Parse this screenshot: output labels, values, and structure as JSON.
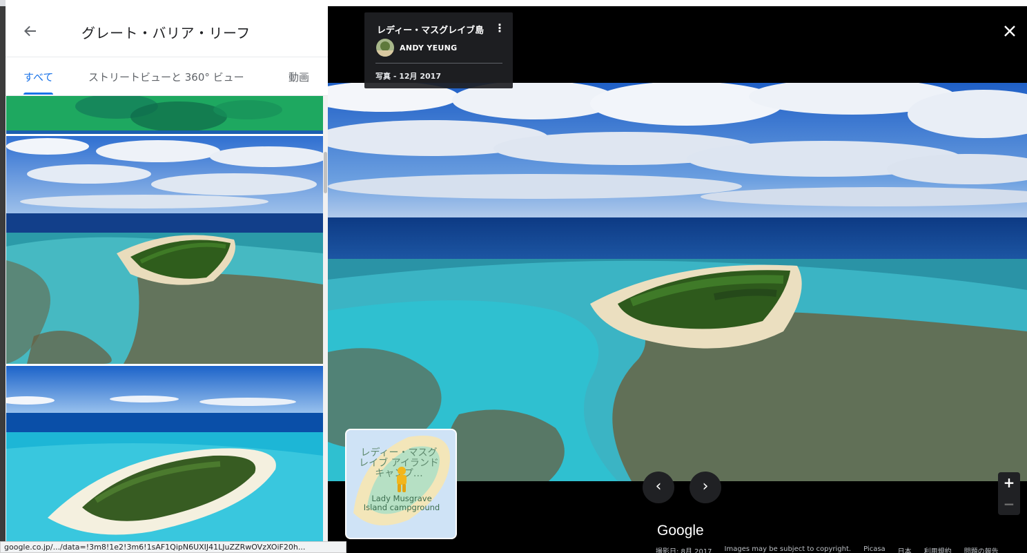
{
  "panel": {
    "title": "グレート・バリア・リーフ",
    "back_icon": "arrow-left-icon",
    "tabs": [
      {
        "label": "すべて",
        "active": true
      },
      {
        "label": "ストリートビューと 360° ビュー",
        "active": false
      },
      {
        "label": "動画",
        "active": false
      }
    ],
    "collapse_icon": "caret-left-icon"
  },
  "photo_info": {
    "title": "レディー・マスグレイブ島",
    "author": "ANDY YEUNG",
    "date": "写真 - 12月 2017"
  },
  "mini_map": {
    "label_jp": "レディー・マスグレイブ アイランド キャンプ…",
    "label_en": "Lady Musgrave Island campground"
  },
  "nav": {
    "prev_icon": "chevron-left-icon",
    "next_icon": "chevron-right-icon",
    "close_icon": "close-icon"
  },
  "zoom": {
    "in_label": "+",
    "out_label": "−"
  },
  "brand": "Google",
  "footer": {
    "capture_date": "撮影日: 8月 2017",
    "copyright": "Images may be subject to copyright.",
    "picasa": "Picasa",
    "country": "日本",
    "terms": "利用規約",
    "report": "問題の報告"
  },
  "status_url": "google.co.jp/.../data=!3m8!1e2!3m6!1sAF1QipN6UXIJ41LJuZZRwOVzXOiF20h...",
  "colors": {
    "accent": "#1a73e8",
    "card_bg": "#202124"
  }
}
